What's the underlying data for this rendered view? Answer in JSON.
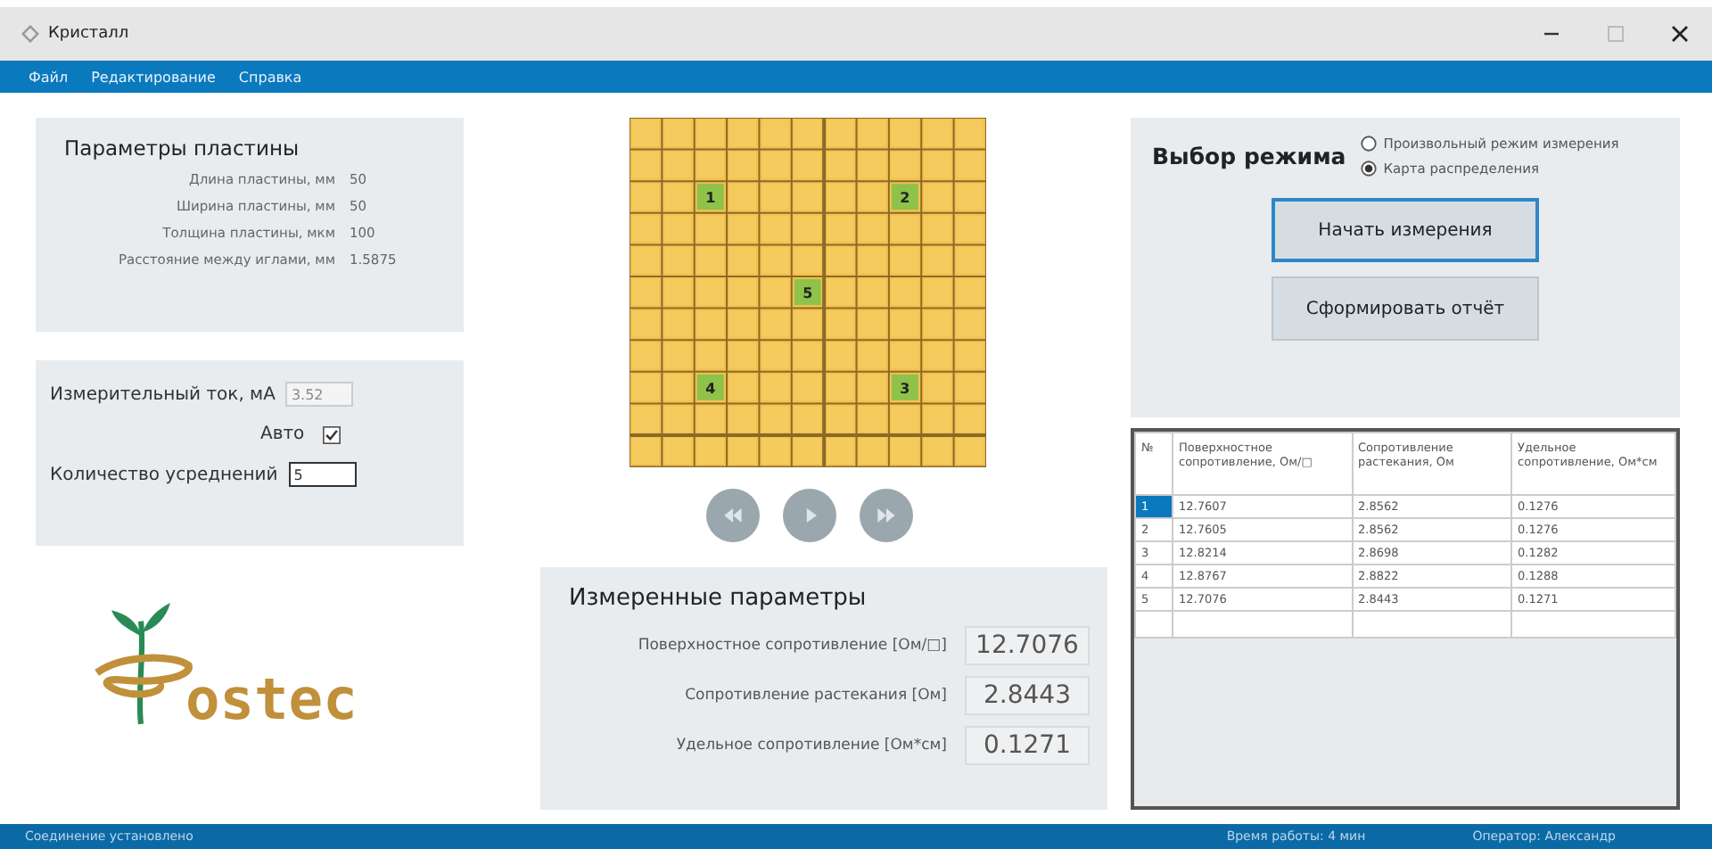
{
  "window": {
    "title": "Кристалл"
  },
  "menu": [
    "Файл",
    "Редактирование",
    "Справка"
  ],
  "plate": {
    "title": "Параметры пластины",
    "params": [
      {
        "label": "Длина пластины, мм",
        "value": "50"
      },
      {
        "label": "Ширина пластины, мм",
        "value": "50"
      },
      {
        "label": "Толщина пластины, мкм",
        "value": "100"
      },
      {
        "label": "Расстояние между иглами, мм",
        "value": "1.5875"
      }
    ]
  },
  "settings": {
    "current": {
      "label": "Измерительный ток, мА",
      "value": "3.52",
      "disabled": true
    },
    "auto": {
      "label": "Авто",
      "checked": true
    },
    "averaging": {
      "label": "Количество усреднений",
      "value": "5",
      "disabled": false
    }
  },
  "logo": {
    "text": "ostec"
  },
  "grid": {
    "rows": [
      [
        {
          "marked": false
        },
        {
          "marked": false
        },
        {
          "marked": false
        },
        {
          "marked": false
        },
        {
          "marked": false
        },
        {
          "marked": false
        },
        {
          "marked": false
        },
        {
          "marked": false
        },
        {
          "marked": false
        },
        {
          "marked": false
        },
        {
          "marked": false
        }
      ],
      [
        {
          "marked": false
        },
        {
          "marked": false
        },
        {
          "marked": false
        },
        {
          "marked": false
        },
        {
          "marked": false
        },
        {
          "marked": false
        },
        {
          "marked": false
        },
        {
          "marked": false
        },
        {
          "marked": false
        },
        {
          "marked": false
        },
        {
          "marked": false
        }
      ],
      [
        {
          "marked": false
        },
        {
          "marked": false
        },
        {
          "marked": true,
          "label": "1"
        },
        {
          "marked": false
        },
        {
          "marked": false
        },
        {
          "marked": false
        },
        {
          "marked": false
        },
        {
          "marked": false
        },
        {
          "marked": true,
          "label": "2"
        },
        {
          "marked": false
        },
        {
          "marked": false
        }
      ],
      [
        {
          "marked": false
        },
        {
          "marked": false
        },
        {
          "marked": false
        },
        {
          "marked": false
        },
        {
          "marked": false
        },
        {
          "marked": false
        },
        {
          "marked": false
        },
        {
          "marked": false
        },
        {
          "marked": false
        },
        {
          "marked": false
        },
        {
          "marked": false
        }
      ],
      [
        {
          "marked": false
        },
        {
          "marked": false
        },
        {
          "marked": false
        },
        {
          "marked": false
        },
        {
          "marked": false
        },
        {
          "marked": false
        },
        {
          "marked": false
        },
        {
          "marked": false
        },
        {
          "marked": false
        },
        {
          "marked": false
        },
        {
          "marked": false
        }
      ],
      [
        {
          "marked": false
        },
        {
          "marked": false
        },
        {
          "marked": false
        },
        {
          "marked": false
        },
        {
          "marked": false
        },
        {
          "marked": true,
          "label": "5"
        },
        {
          "marked": false
        },
        {
          "marked": false
        },
        {
          "marked": false
        },
        {
          "marked": false
        },
        {
          "marked": false
        }
      ],
      [
        {
          "marked": false
        },
        {
          "marked": false
        },
        {
          "marked": false
        },
        {
          "marked": false
        },
        {
          "marked": false
        },
        {
          "marked": false
        },
        {
          "marked": false
        },
        {
          "marked": false
        },
        {
          "marked": false
        },
        {
          "marked": false
        },
        {
          "marked": false
        }
      ],
      [
        {
          "marked": false
        },
        {
          "marked": false
        },
        {
          "marked": false
        },
        {
          "marked": false
        },
        {
          "marked": false
        },
        {
          "marked": false
        },
        {
          "marked": false
        },
        {
          "marked": false
        },
        {
          "marked": false
        },
        {
          "marked": false
        },
        {
          "marked": false
        }
      ],
      [
        {
          "marked": false
        },
        {
          "marked": false
        },
        {
          "marked": true,
          "label": "4"
        },
        {
          "marked": false
        },
        {
          "marked": false
        },
        {
          "marked": false
        },
        {
          "marked": false
        },
        {
          "marked": false
        },
        {
          "marked": true,
          "label": "3"
        },
        {
          "marked": false
        },
        {
          "marked": false
        }
      ],
      [
        {
          "marked": false
        },
        {
          "marked": false
        },
        {
          "marked": false
        },
        {
          "marked": false
        },
        {
          "marked": false
        },
        {
          "marked": false
        },
        {
          "marked": false
        },
        {
          "marked": false
        },
        {
          "marked": false
        },
        {
          "marked": false
        },
        {
          "marked": false
        }
      ],
      [
        {
          "marked": false
        },
        {
          "marked": false
        },
        {
          "marked": false
        },
        {
          "marked": false
        },
        {
          "marked": false
        },
        {
          "marked": false
        },
        {
          "marked": false
        },
        {
          "marked": false
        },
        {
          "marked": false
        },
        {
          "marked": false
        },
        {
          "marked": false
        }
      ]
    ]
  },
  "nav": [
    {
      "kind": "rewind"
    },
    {
      "kind": "play"
    },
    {
      "kind": "forward"
    }
  ],
  "measured": {
    "title": "Измеренные параметры",
    "params": [
      {
        "label": "Поверхностное сопротивление [Ом/□]",
        "value": "12.7076"
      },
      {
        "label": "Сопротивление растекания [Ом]",
        "value": "2.8443"
      },
      {
        "label": "Удельное сопротивление [Ом*см]",
        "value": "0.1271"
      }
    ]
  },
  "mode": {
    "title": "Выбор режима",
    "options": [
      {
        "label": "Произвольный режим измерения",
        "selected": false
      },
      {
        "label": "Карта распределения",
        "selected": true
      }
    ],
    "buttons": [
      "Начать измерения",
      "Сформировать отчёт"
    ]
  },
  "table": {
    "columns": [
      "№",
      "Поверхностное сопротивление, Ом/□",
      "Сопротивление растекания, Ом",
      "Удельное сопротивление, Ом*см"
    ],
    "rows": [
      {
        "cells": [
          "1",
          "12.7607",
          "2.8562",
          "0.1276"
        ],
        "selected": true
      },
      {
        "cells": [
          "2",
          "12.7605",
          "2.8562",
          "0.1276"
        ],
        "selected": false
      },
      {
        "cells": [
          "3",
          "12.8214",
          "2.8698",
          "0.1282"
        ],
        "selected": false
      },
      {
        "cells": [
          "4",
          "12.8767",
          "2.8822",
          "0.1288"
        ],
        "selected": false
      },
      {
        "cells": [
          "5",
          "12.7076",
          "2.8443",
          "0.1271"
        ],
        "selected": false
      }
    ]
  },
  "status_bar": {
    "connection": "Соединение установлено",
    "uptime": "Время работы: 4 мин",
    "operator": "Оператор: Александр"
  }
}
